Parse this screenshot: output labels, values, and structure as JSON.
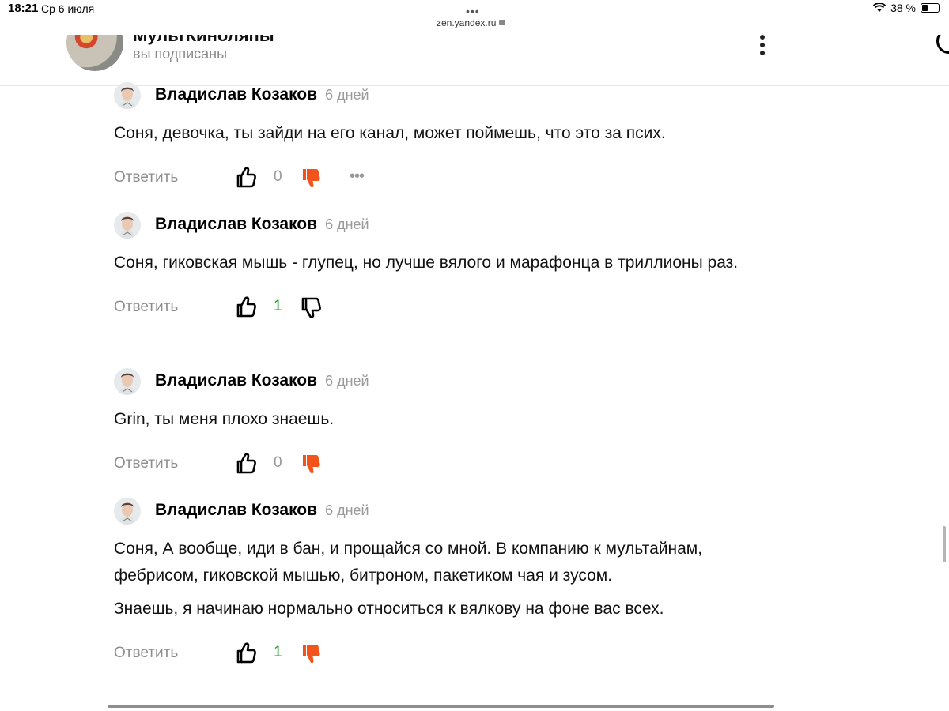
{
  "status_bar": {
    "time": "18:21",
    "date": "Ср 6 июля",
    "url": "zen.yandex.ru",
    "battery": "38 %"
  },
  "channel": {
    "name": "МультКиноляпы",
    "subscription": "вы подписаны"
  },
  "comments": [
    {
      "author": "Владислав Козаков",
      "time": "6 дней",
      "paragraphs": [
        "Соня, девочка, ты зайди на его канал, может поймешь, что это за псих."
      ],
      "reply_label": "Ответить",
      "likes": "0",
      "likes_color": "gray",
      "dislike_active": true,
      "has_more": true
    },
    {
      "author": "Владислав Козаков",
      "time": "6 дней",
      "paragraphs": [
        "Соня, гиковская мышь - глупец, но лучше вялого и марафонца в триллионы раз."
      ],
      "reply_label": "Ответить",
      "likes": "1",
      "likes_color": "green",
      "dislike_active": false,
      "has_more": false
    },
    {
      "author": "Владислав Козаков",
      "time": "6 дней",
      "paragraphs": [
        "Grin, ты меня плохо знаешь."
      ],
      "reply_label": "Ответить",
      "likes": "0",
      "likes_color": "gray",
      "dislike_active": true,
      "has_more": false
    },
    {
      "author": "Владислав Козаков",
      "time": "6 дней",
      "paragraphs": [
        "Соня, А вообще, иди в бан, и прощайся со мной. В компанию к мультайнам, фебрисом, гиковской мышью, битроном, пакетиком чая и зусом.",
        "Знаешь, я начинаю нормально относиться к вялкову на фоне вас всех."
      ],
      "reply_label": "Ответить",
      "likes": "1",
      "likes_color": "green",
      "dislike_active": true,
      "has_more": false
    }
  ],
  "colors": {
    "dislike_active": "#f2541b",
    "like_positive": "#1aa11f",
    "muted": "#8e8e8e"
  }
}
